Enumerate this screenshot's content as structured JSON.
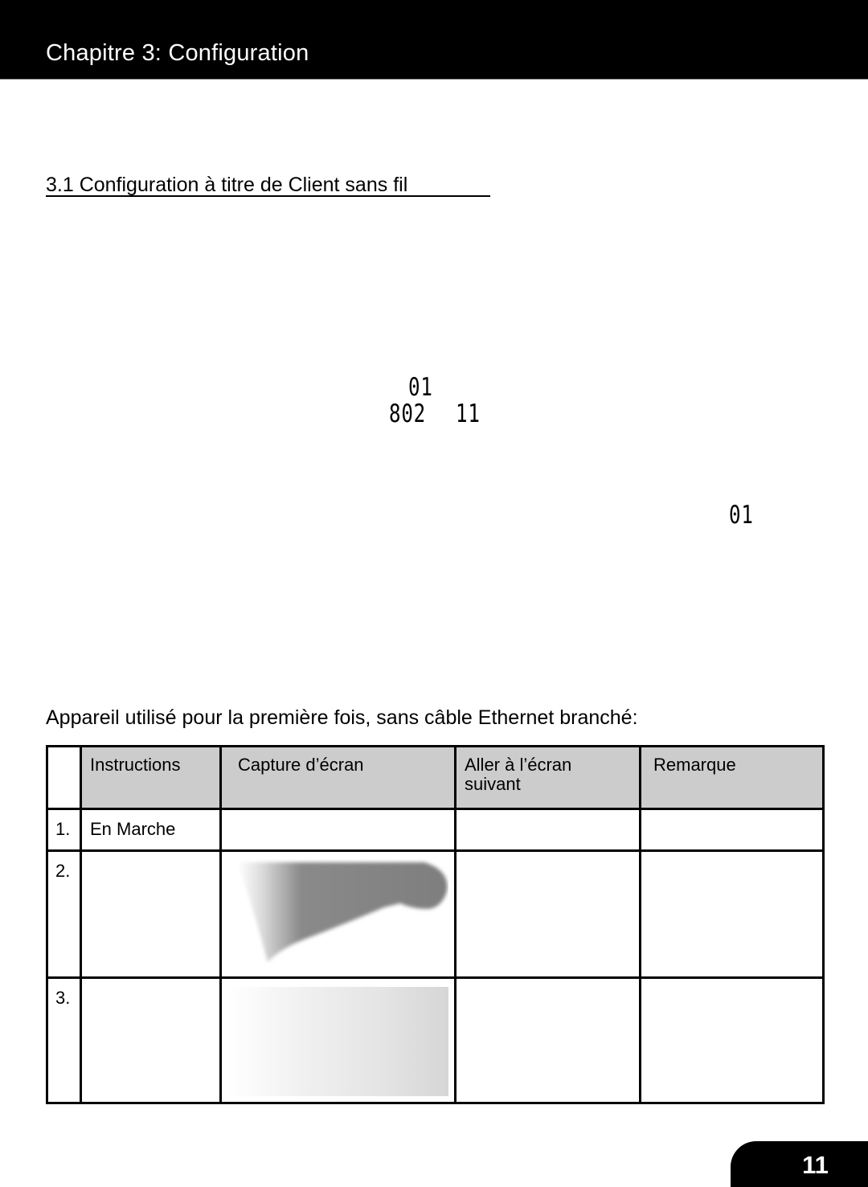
{
  "header": {
    "chapter_title": "Chapitre 3: Configuration"
  },
  "section": {
    "title": "3.1 Configuration à titre de Client sans fil"
  },
  "lcd_readouts": {
    "first": "01",
    "standard_prefix": "802",
    "standard_suffix": "11",
    "second": "01"
  },
  "intro_text": "Appareil utilisé pour la première fois, sans câble Ethernet branché:",
  "table": {
    "headers": [
      "",
      "Instructions",
      "Capture d’écran",
      "Aller à l’écran suivant",
      "Remarque"
    ],
    "rows": [
      {
        "num": "1.",
        "instruction": "En Marche",
        "capture": "",
        "next": "",
        "remark": ""
      },
      {
        "num": "2.",
        "instruction": "",
        "capture": "screenshot-image",
        "next": "",
        "remark": ""
      },
      {
        "num": "3.",
        "instruction": "",
        "capture": "screenshot-image",
        "next": "",
        "remark": ""
      }
    ]
  },
  "footer": {
    "page_number": "11"
  },
  "colors": {
    "header_bg": "#000000",
    "header_text": "#ffffff",
    "table_header_bg": "#cccccc",
    "page_tab_bg": "#000000"
  }
}
